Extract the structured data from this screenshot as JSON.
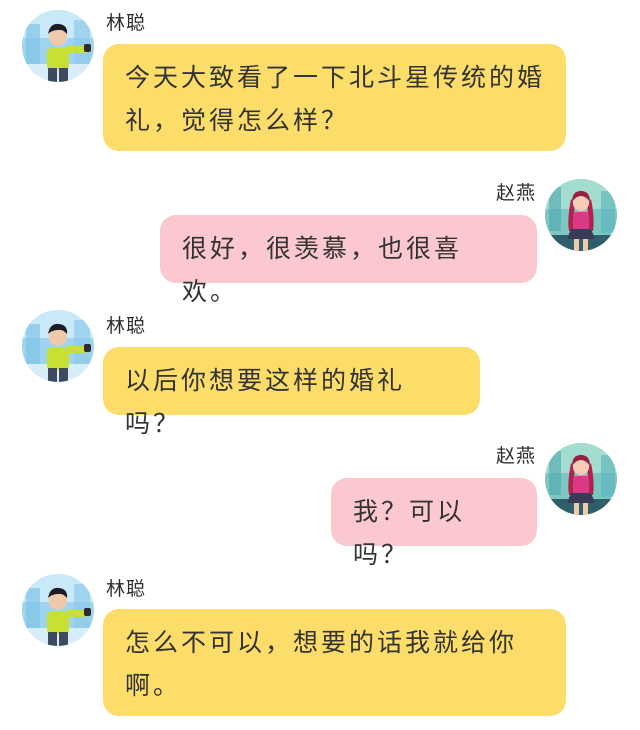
{
  "chat": {
    "messages": [
      {
        "sender": "林聪",
        "side": "left",
        "bubble_color": "#fcdd6a",
        "avatar": "boy-yellow-shirt-avatar",
        "text": "今天大致看了一下北斗星传统的婚礼，觉得怎么样？"
      },
      {
        "sender": "赵燕",
        "side": "right",
        "bubble_color": "#fbc8cf",
        "avatar": "girl-pink-outfit-avatar",
        "text": "很好，很羡慕，也很喜欢。"
      },
      {
        "sender": "林聪",
        "side": "left",
        "bubble_color": "#fcdd6a",
        "avatar": "boy-yellow-shirt-avatar",
        "text": "以后你想要这样的婚礼吗？"
      },
      {
        "sender": "赵燕",
        "side": "right",
        "bubble_color": "#fbc8cf",
        "avatar": "girl-pink-outfit-avatar",
        "text": "我？可以吗？"
      },
      {
        "sender": "林聪",
        "side": "left",
        "bubble_color": "#fcdd6a",
        "avatar": "boy-yellow-shirt-avatar",
        "text": "怎么不可以，想要的话我就给你啊。"
      }
    ]
  }
}
